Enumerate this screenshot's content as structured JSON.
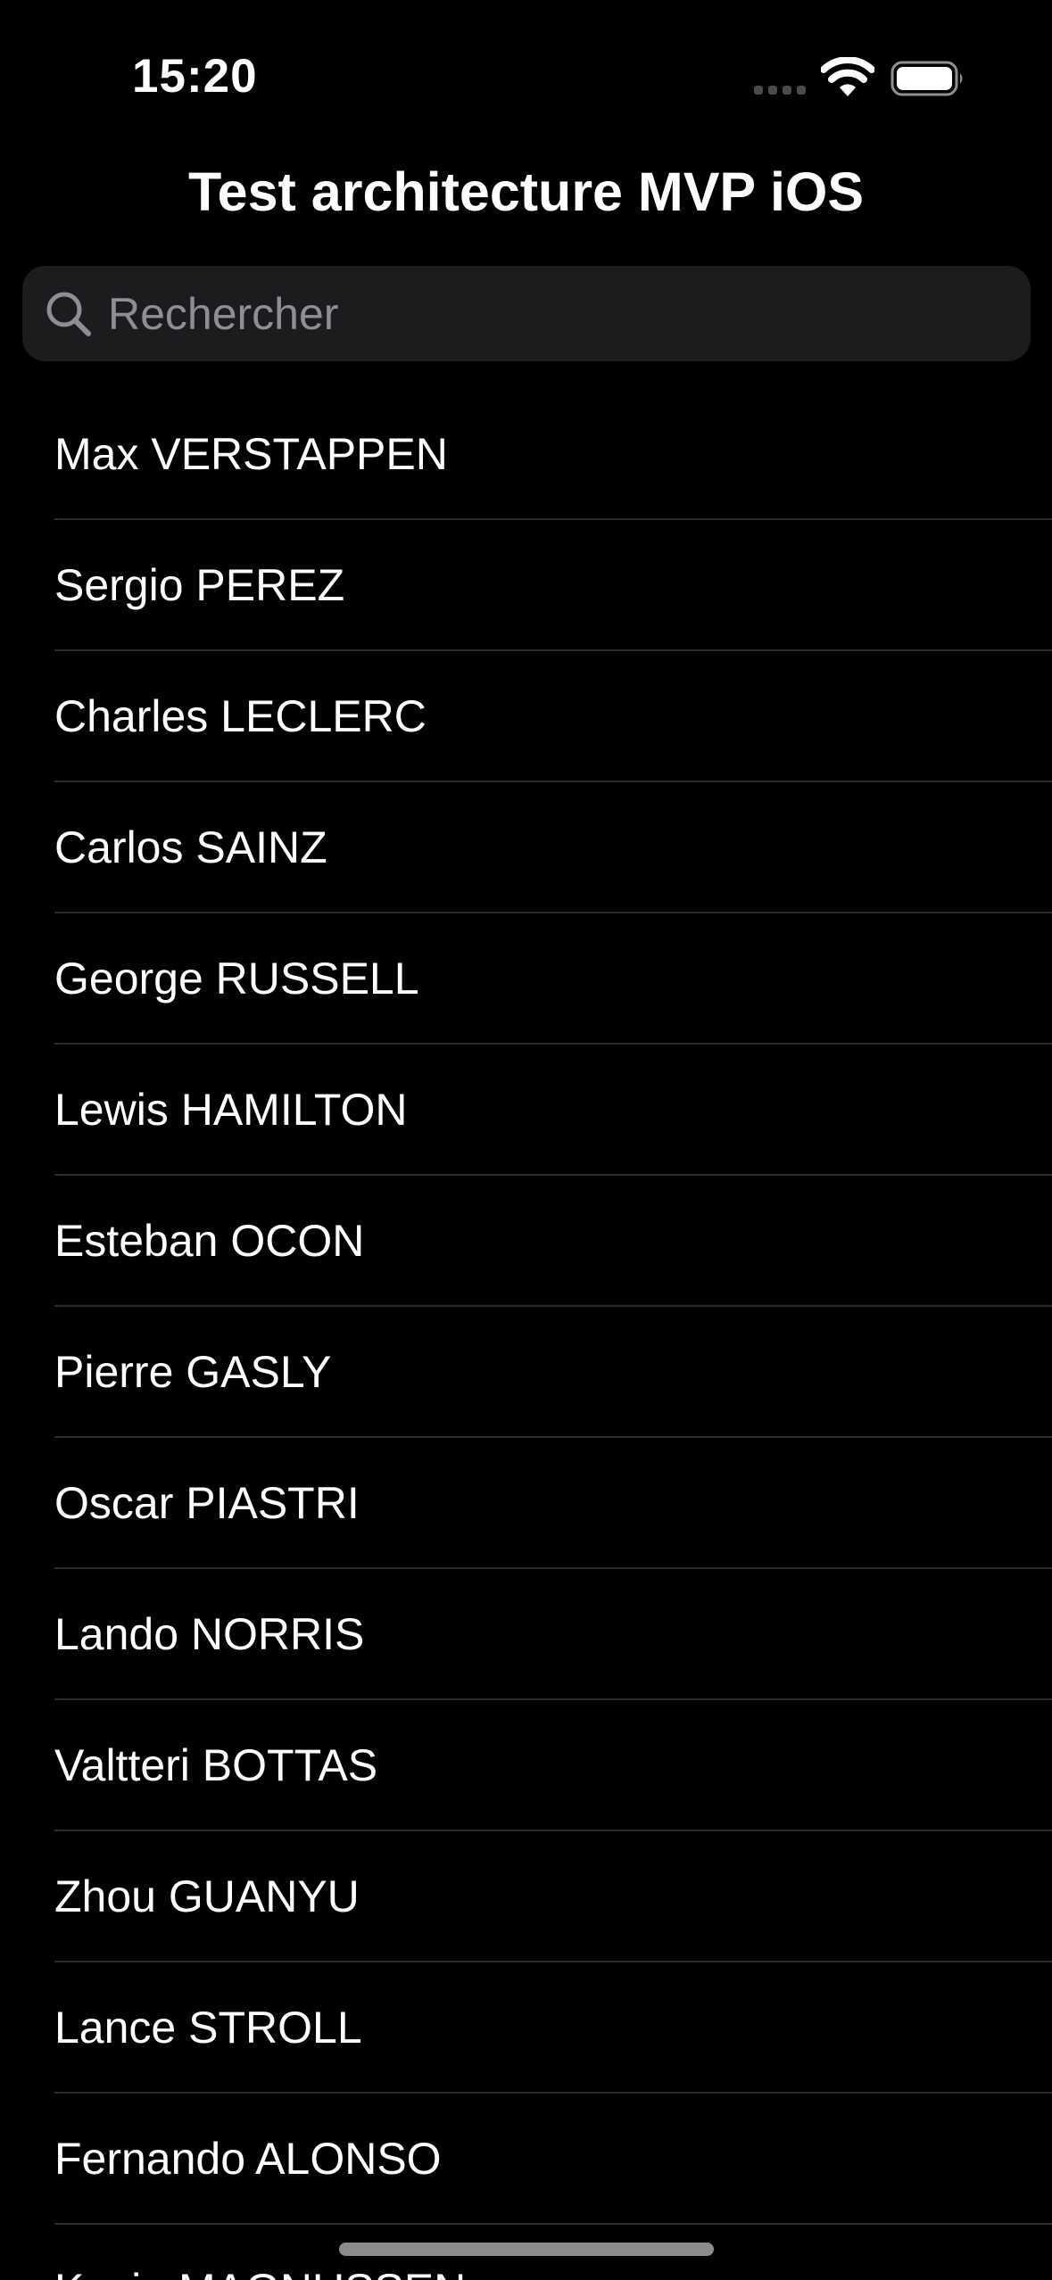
{
  "status_bar": {
    "time": "15:20",
    "signal_icon": "cellular-signal-icon",
    "wifi_icon": "wifi-icon",
    "battery_icon": "battery-icon"
  },
  "nav": {
    "title": "Test architecture MVP iOS"
  },
  "search": {
    "placeholder": "Rechercher",
    "value": "",
    "icon": "magnifying-glass-icon"
  },
  "drivers": [
    "Max VERSTAPPEN",
    "Sergio PEREZ",
    "Charles LECLERC",
    "Carlos SAINZ",
    "George RUSSELL",
    "Lewis HAMILTON",
    "Esteban OCON",
    "Pierre GASLY",
    "Oscar PIASTRI",
    "Lando NORRIS",
    "Valtteri BOTTAS",
    "Zhou GUANYU",
    "Lance STROLL",
    "Fernando ALONSO",
    "Kevin MAGNUSSEN"
  ],
  "colors": {
    "background": "#000000",
    "search_field": "#1c1c1e",
    "placeholder": "#8e8e93",
    "separator": "#2a2a2c",
    "text": "#ffffff"
  }
}
